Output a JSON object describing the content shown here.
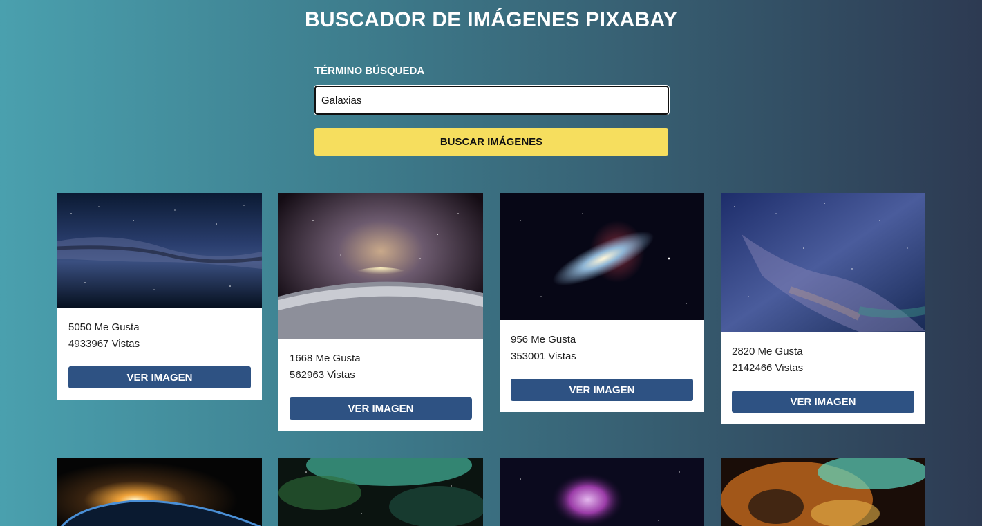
{
  "header": {
    "title": "BUSCADOR DE IMÁGENES PIXABAY"
  },
  "search": {
    "label": "TÉRMINO BÚSQUEDA",
    "value": "Galaxias",
    "button_label": "BUSCAR IMÁGENES"
  },
  "results": [
    {
      "likes": "5050 Me Gusta",
      "views": "4933967 Vistas",
      "button": "VER IMAGEN",
      "image_icon": "milky-way-image"
    },
    {
      "likes": "1668 Me Gusta",
      "views": "562963 Vistas",
      "button": "VER IMAGEN",
      "image_icon": "planet-horizon-galaxy-image"
    },
    {
      "likes": "956 Me Gusta",
      "views": "353001 Vistas",
      "button": "VER IMAGEN",
      "image_icon": "spiral-galaxy-image"
    },
    {
      "likes": "2820 Me Gusta",
      "views": "2142466 Vistas",
      "button": "VER IMAGEN",
      "image_icon": "starfield-nebula-image"
    },
    {
      "image_icon": "sunrise-over-earth-image"
    },
    {
      "image_icon": "green-nebula-image"
    },
    {
      "image_icon": "purple-nebula-image"
    },
    {
      "image_icon": "orange-nebula-image"
    }
  ],
  "colors": {
    "accent_button": "#f6de5e",
    "view_button": "#2e5283",
    "background_start": "#4aa0ae",
    "background_end": "#2d3a52"
  }
}
